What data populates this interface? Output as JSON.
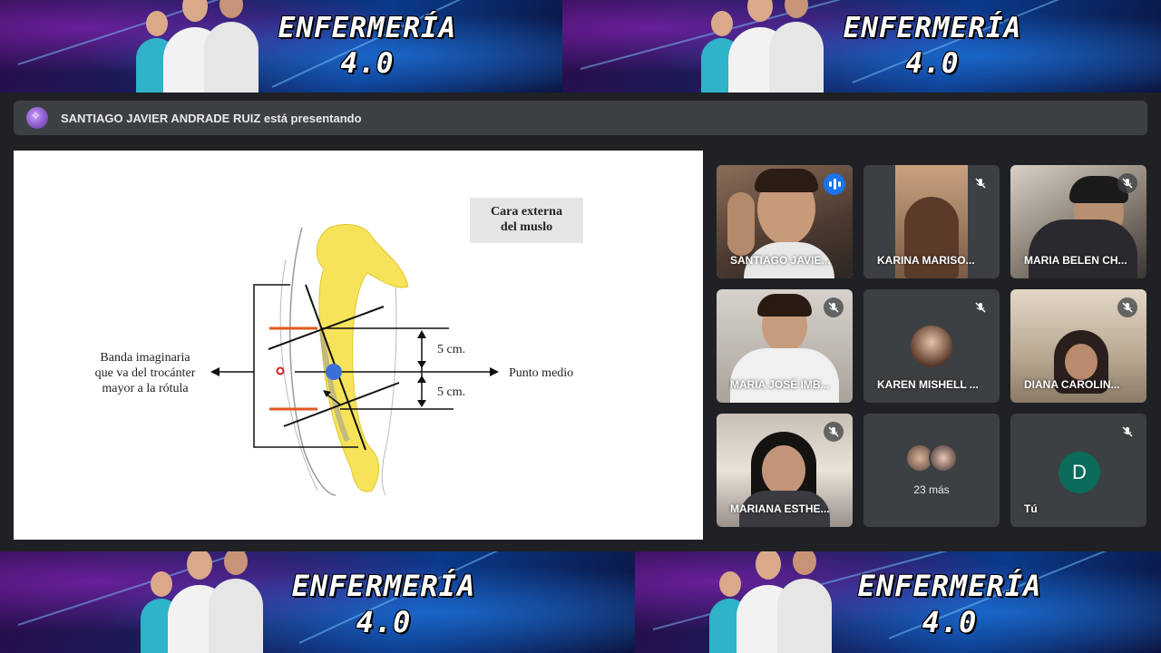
{
  "banner": {
    "title_line1": "ENFERMERÍA",
    "title_line2": "4.0"
  },
  "presenting": {
    "text": "SANTIAGO JAVIER ANDRADE RUIZ está presentando"
  },
  "slide": {
    "box_label_line1": "Cara externa",
    "box_label_line2": "del muslo",
    "left_label_line1": "Banda imaginaria",
    "left_label_line2": "que va del trocánter",
    "left_label_line3": "mayor a la rótula",
    "measure_top": "5 cm.",
    "measure_bottom": "5 cm.",
    "right_label": "Punto medio"
  },
  "participants": [
    {
      "name": "SANTIAGO JAVIE...",
      "speaking": true
    },
    {
      "name": "KARINA MARISO...",
      "muted": true
    },
    {
      "name": "MARIA BELEN CH...",
      "muted": true
    },
    {
      "name": "MARIA JOSÉ IMB...",
      "muted": true
    },
    {
      "name": "KAREN MISHELL ...",
      "muted": true
    },
    {
      "name": "DIANA CAROLIN...",
      "muted": true
    },
    {
      "name": "MARIANA ESTHE...",
      "muted": true
    },
    {
      "name": "23 más"
    },
    {
      "name": "Tú",
      "avatar_letter": "D",
      "muted": true
    }
  ],
  "colors": {
    "accent_blue": "#1a73e8",
    "self_avatar": "#0b6b5b",
    "tile_bg": "#3c4043",
    "page_bg": "#202124"
  }
}
